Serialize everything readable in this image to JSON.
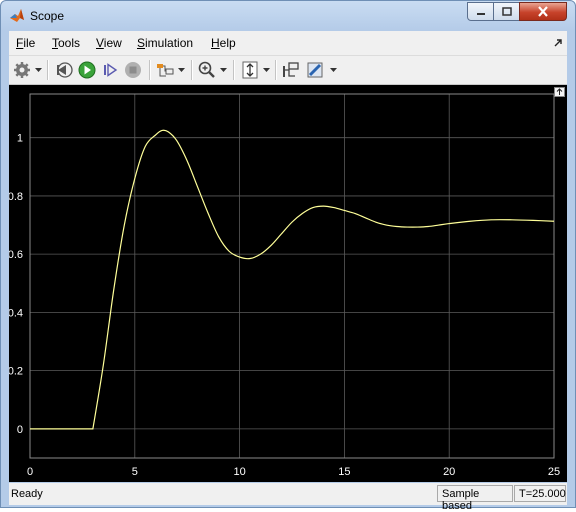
{
  "window": {
    "title": "Scope",
    "icon": "matlab-logo-icon"
  },
  "menu": {
    "items": [
      {
        "label": "File",
        "key": "F",
        "rest": "ile"
      },
      {
        "label": "Tools",
        "key": "T",
        "rest": "ools"
      },
      {
        "label": "View",
        "key": "V",
        "rest": "iew"
      },
      {
        "label": "Simulation",
        "key": "S",
        "rest": "imulation"
      },
      {
        "label": "Help",
        "key": "H",
        "rest": "elp"
      }
    ]
  },
  "toolbar": {
    "icons": [
      "gear-icon",
      "step-back-icon",
      "run-icon",
      "step-forward-icon",
      "stop-icon",
      "signal-selector-icon",
      "zoom-in-icon",
      "scale-y-axis-icon",
      "highlight-simulink-block-icon",
      "style-icon"
    ]
  },
  "colors": {
    "plot_background": "#000000",
    "grid": "#5a5a5a",
    "signal": "#ffff99",
    "tick_label": "#ffffff"
  },
  "chart_data": {
    "type": "line",
    "xlim": [
      0,
      25
    ],
    "ylim": [
      -0.1,
      1.15
    ],
    "x_ticks": [
      0,
      5,
      10,
      15,
      20,
      25
    ],
    "y_ticks": [
      0,
      0.2,
      0.4,
      0.6,
      0.8,
      1
    ],
    "y_tick_labels": [
      "0",
      "0.2",
      "0.4",
      "0.6",
      "0.8",
      "1"
    ],
    "grid": true,
    "series": [
      {
        "x": [
          0,
          3,
          3.5,
          4,
          4.5,
          5,
          5.5,
          6,
          6.3,
          6.6,
          7,
          7.5,
          8,
          8.5,
          9,
          9.5,
          10,
          10.5,
          11,
          11.5,
          12,
          12.5,
          13,
          13.5,
          14,
          14.5,
          15,
          15.5,
          16,
          16.5,
          17,
          17.5,
          18,
          18.5,
          19,
          19.5,
          20,
          21,
          22,
          23,
          24,
          25
        ],
        "y": [
          0,
          0,
          0.22,
          0.48,
          0.7,
          0.86,
          0.97,
          1.01,
          1.025,
          1.02,
          0.99,
          0.92,
          0.83,
          0.74,
          0.66,
          0.61,
          0.59,
          0.585,
          0.6,
          0.63,
          0.67,
          0.71,
          0.74,
          0.76,
          0.765,
          0.76,
          0.75,
          0.74,
          0.725,
          0.71,
          0.7,
          0.695,
          0.693,
          0.693,
          0.695,
          0.7,
          0.705,
          0.713,
          0.718,
          0.718,
          0.716,
          0.713
        ]
      }
    ]
  },
  "status": {
    "state": "Ready",
    "mode": "Sample based",
    "time": "T=25.000"
  }
}
